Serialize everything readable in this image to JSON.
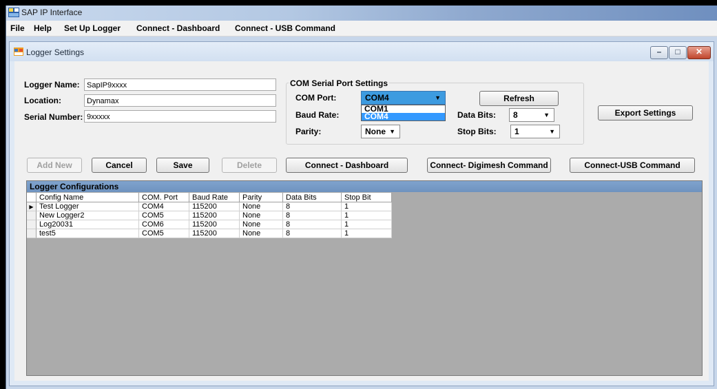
{
  "app": {
    "title": "SAP IP Interface"
  },
  "menu": [
    "File",
    "Help",
    "Set Up Logger",
    "Connect - Dashboard",
    "Connect - USB Command"
  ],
  "child_window": {
    "title": "Logger Settings",
    "minimize": "–",
    "maximize": "□",
    "close": "✕"
  },
  "logger": {
    "name_label": "Logger Name:",
    "name_value": "SapIP9xxxx",
    "location_label": "Location:",
    "location_value": "Dynamax",
    "serial_label": "Serial Number:",
    "serial_value": "9xxxxx"
  },
  "com_settings": {
    "group_title": "COM Serial Port Settings",
    "com_port_label": "COM Port:",
    "com_port_value": "COM4",
    "com_port_options": [
      "COM1",
      "COM4"
    ],
    "baud_rate_label": "Baud Rate:",
    "parity_label": "Parity:",
    "parity_value": "None",
    "data_bits_label": "Data Bits:",
    "data_bits_value": "8",
    "stop_bits_label": "Stop Bits:",
    "stop_bits_value": "1",
    "refresh_label": "Refresh"
  },
  "export_label": "Export Settings",
  "actions": {
    "add_new": "Add New",
    "cancel": "Cancel",
    "save": "Save",
    "delete": "Delete",
    "connect_dashboard": "Connect - Dashboard",
    "connect_digimesh": "Connect- Digimesh Command",
    "connect_usb": "Connect-USB Command"
  },
  "grid": {
    "caption": "Logger Configurations",
    "columns": [
      "Config Name",
      "COM. Port",
      "Baud Rate",
      "Parity",
      "Data Bits",
      "Stop Bit"
    ],
    "rows": [
      [
        "Test Logger",
        "COM4",
        "115200",
        "None",
        "8",
        "1"
      ],
      [
        "New Logger2",
        "COM5",
        "115200",
        "None",
        "8",
        "1"
      ],
      [
        "Log20031",
        "COM6",
        "115200",
        "None",
        "8",
        "1"
      ],
      [
        "test5",
        "COM5",
        "115200",
        "None",
        "8",
        "1"
      ]
    ],
    "current_row_marker": "▶"
  },
  "icons": {
    "app": "app-window-icon",
    "child": "form-icon",
    "dropdown_arrow": "▼"
  }
}
